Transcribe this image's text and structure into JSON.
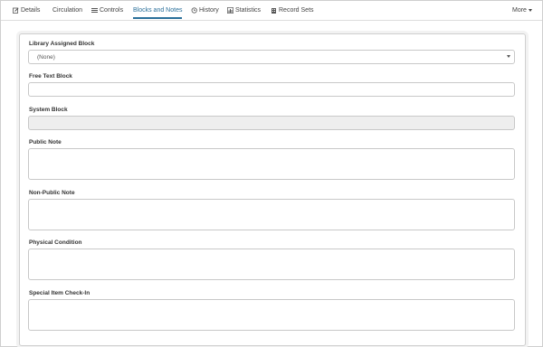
{
  "tabs": [
    {
      "label": "Details",
      "icon": "edit-icon"
    },
    {
      "label": "Circulation",
      "icon": ""
    },
    {
      "label": "Controls",
      "icon": "list-icon"
    },
    {
      "label": "Blocks and Notes",
      "icon": ""
    },
    {
      "label": "History",
      "icon": "history-icon"
    },
    {
      "label": "Statistics",
      "icon": "bar-chart-icon"
    },
    {
      "label": "Record Sets",
      "icon": "building-icon"
    }
  ],
  "more_label": "More",
  "active_tab": "Blocks and Notes",
  "accent_color": "#2a6f9a",
  "form": {
    "library_block_label": "Library Assigned Block",
    "library_block_value": "(None)",
    "free_text_label": "Free Text Block",
    "free_text_value": "",
    "system_block_label": "System Block",
    "system_block_value": "",
    "public_note_label": "Public Note",
    "public_note_value": "",
    "non_public_note_label": "Non-Public Note",
    "non_public_note_value": "",
    "physical_condition_label": "Physical Condition",
    "physical_condition_value": "",
    "special_checkin_label": "Special Item Check-In",
    "special_checkin_value": ""
  }
}
